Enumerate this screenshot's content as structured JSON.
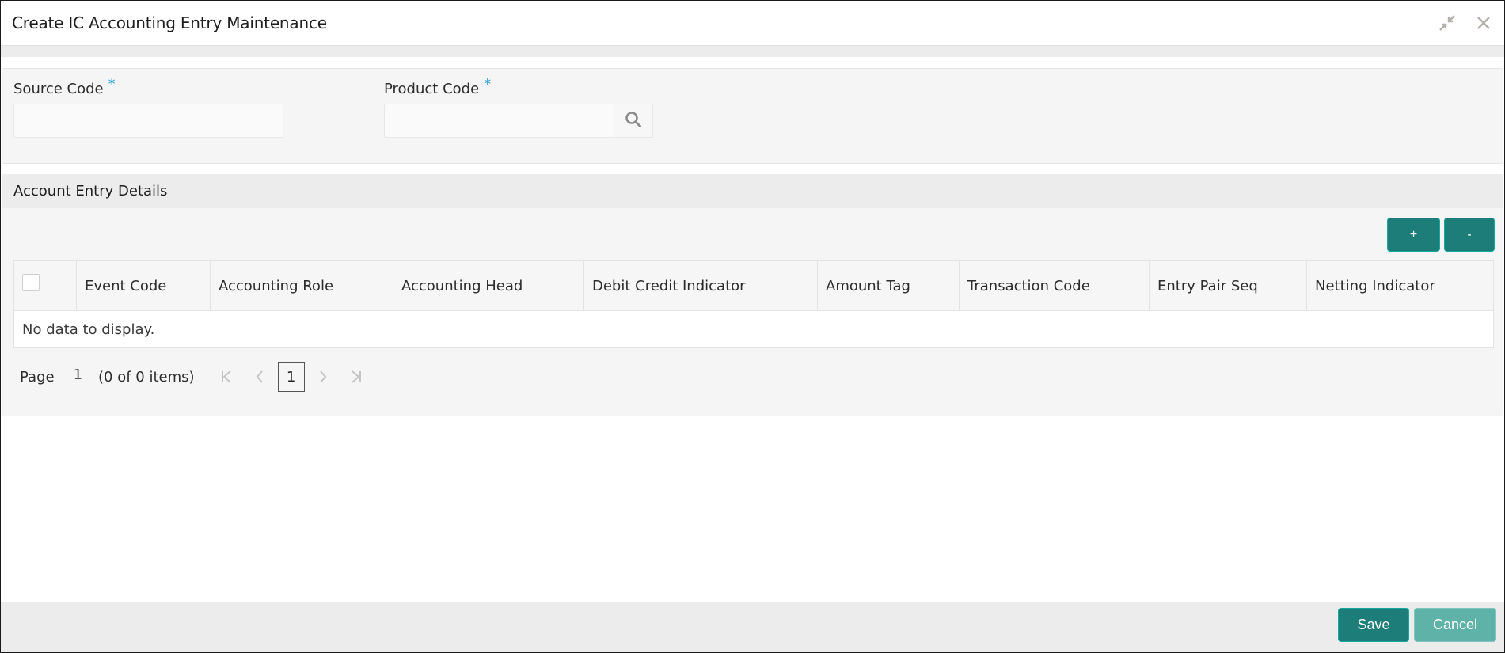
{
  "window": {
    "title": "Create IC Accounting Entry Maintenance",
    "icons": [
      "minimize-icon",
      "close-icon"
    ]
  },
  "form": {
    "source_code": {
      "label": "Source Code",
      "required_mark": "*",
      "value": "",
      "placeholder": ""
    },
    "product_code": {
      "label": "Product Code",
      "required_mark": "*",
      "value": "",
      "placeholder": "",
      "lookup_icon": "search-icon"
    }
  },
  "account_entry": {
    "section_title": "Account Entry Details",
    "add_label": "+",
    "remove_label": "-",
    "columns": [
      "Event Code",
      "Accounting Role",
      "Accounting Head",
      "Debit Credit Indicator",
      "Amount Tag",
      "Transaction Code",
      "Entry Pair Seq",
      "Netting Indicator"
    ],
    "rows": [],
    "empty_message": "No data to display.",
    "pagination": {
      "page_label": "Page",
      "page_number": "1",
      "items_text": "(0 of 0 items)",
      "current_page": "1",
      "first_icon": "K",
      "prev_icon": "‹",
      "next_icon": "›",
      "last_icon": "K"
    }
  },
  "colors": {
    "primary": "#1d7d78",
    "secondary": "#5fb2a8",
    "required": "#2aa3d6"
  },
  "footer": {
    "save_label": "Save",
    "cancel_label": "Cancel"
  }
}
